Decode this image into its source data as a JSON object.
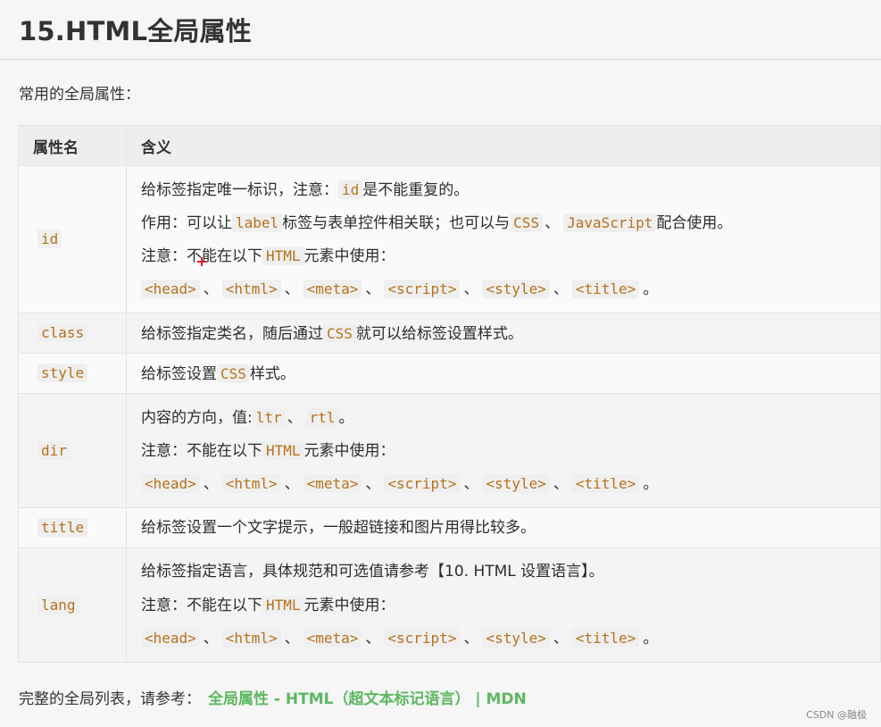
{
  "title": "15.HTML全局属性",
  "intro": "常用的全局属性：",
  "table": {
    "headers": [
      "属性名",
      "含义"
    ],
    "rows": {
      "id": {
        "name": "id",
        "l1": {
          "a": "给标签指定唯一标识，注意：",
          "code": "id",
          "b": "是不能重复的。"
        },
        "l2": {
          "a": "作用：可以让",
          "c1": "label",
          "b": "标签与表单控件相关联；也可以与",
          "c2": "CSS",
          "sep": "、",
          "c3": "JavaScript",
          "c": "配合使用。"
        },
        "l3": {
          "a": "注意：不能在以下",
          "code": "HTML",
          "b": "元素中使用："
        }
      },
      "class": {
        "name": "class",
        "l1": {
          "a": "给标签指定类名，随后通过",
          "code": "CSS",
          "b": "就可以给标签设置样式。"
        }
      },
      "style": {
        "name": "style",
        "l1": {
          "a": "给标签设置",
          "code": "CSS",
          "b": "样式。"
        }
      },
      "dir": {
        "name": "dir",
        "l1": {
          "a": "内容的方向，值:",
          "c1": "ltr",
          "sep": "、",
          "c2": "rtl",
          "b": "。"
        },
        "l2": {
          "a": "注意：不能在以下",
          "code": "HTML",
          "b": "元素中使用："
        }
      },
      "title": {
        "name": "title",
        "l1": {
          "a": "给标签设置一个文字提示，一般超链接和图片用得比较多。"
        }
      },
      "lang": {
        "name": "lang",
        "l1": {
          "a": "给标签指定语言，具体规范和可选值请参考【10. HTML 设置语言】。"
        },
        "l2": {
          "a": "注意：不能在以下",
          "code": "HTML",
          "b": "元素中使用："
        }
      }
    },
    "tags": [
      "<head>",
      "<html>",
      "<meta>",
      "<script>",
      "<style>",
      "<title>"
    ],
    "tag_sep": "、",
    "tag_end": "。"
  },
  "footer": {
    "text": "完整的全局列表，请参考：",
    "link": "全局属性 - HTML（超文本标记语言） | MDN"
  },
  "watermark": "CSDN @融极",
  "colors": {
    "code": "#b7711b",
    "link": "#5cb860"
  }
}
